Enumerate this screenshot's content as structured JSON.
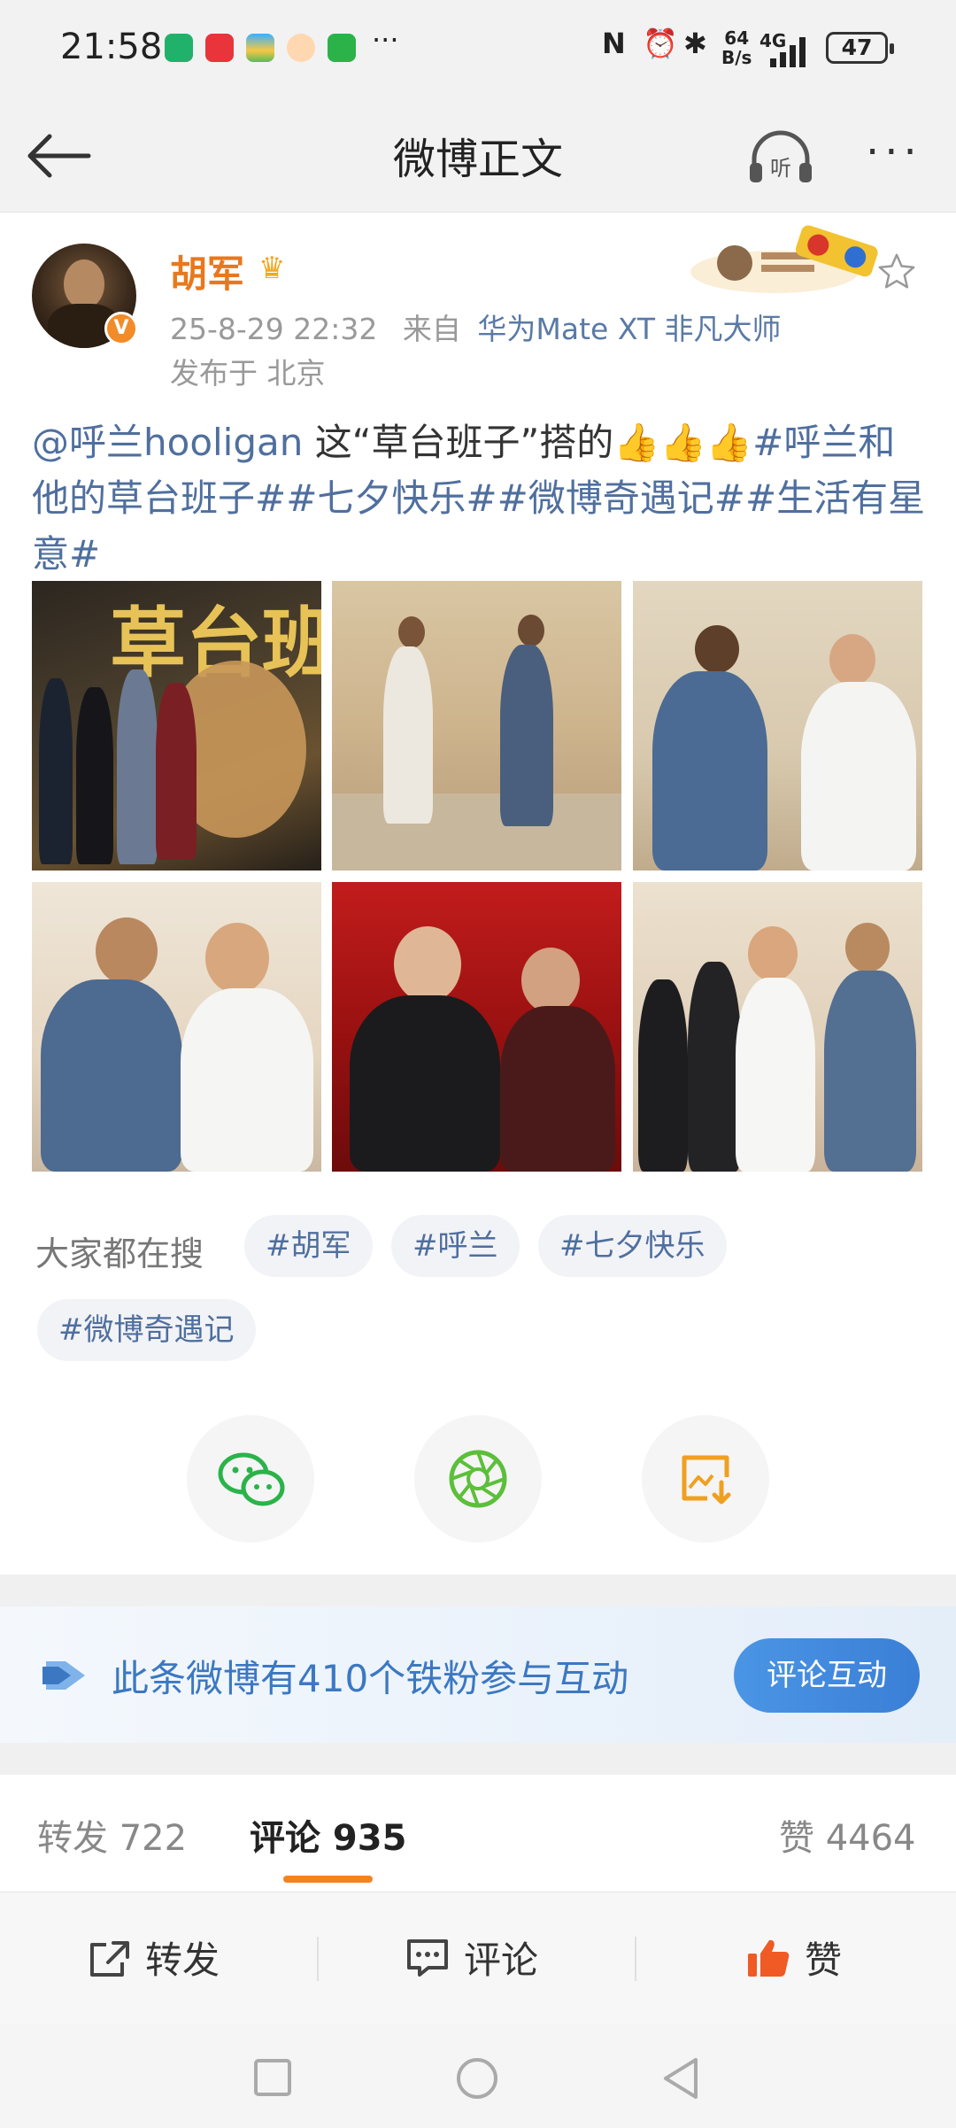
{
  "status_bar": {
    "time": "21:58",
    "net_speed_top": "64",
    "net_speed_bottom": "B/s",
    "network": "4G",
    "battery": "47"
  },
  "nav": {
    "title": "微博正文"
  },
  "post": {
    "user_name": "胡军",
    "verified_mark": "V",
    "date": "25-8-29 22:32",
    "source_prefix": "来自",
    "source": "华为Mate XT 非凡大师",
    "location": "发布于 北京",
    "text": {
      "mention": "@呼兰hooligan",
      "body": " 这“草台班子”搭的",
      "thumbs": "👍👍👍",
      "tags_line": "#呼兰和他的草台班子##七夕快乐##微博奇遇记##生活有星意#"
    },
    "photo1_poster_text": "草台班"
  },
  "search": {
    "label": "大家都在搜",
    "tags": [
      "#胡军",
      "#呼兰",
      "#七夕快乐",
      "#微博奇遇记"
    ]
  },
  "share": {
    "icons": [
      "wechat-icon",
      "moments-icon",
      "save-image-icon"
    ]
  },
  "fan_banner": {
    "text": "此条微博有410个铁粉参与互动",
    "button": "评论互动"
  },
  "tabs": {
    "repost": "转发 722",
    "comment": "评论 935",
    "like": "赞 4464"
  },
  "actions": {
    "repost": "转发",
    "comment": "评论",
    "like": "赞"
  },
  "colors": {
    "accent_orange": "#f58220",
    "link_blue": "#4f6f9e",
    "banner_blue": "#3a7fd6"
  }
}
